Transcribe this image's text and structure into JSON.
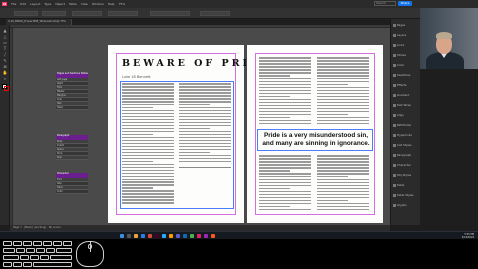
{
  "menubar": {
    "app_logo": "Id",
    "items": [
      "File",
      "Edit",
      "Layout",
      "Type",
      "Object",
      "Table",
      "View",
      "Window",
      "Help"
    ],
    "zoom": "75%",
    "share_label": "Share",
    "search_label": "Search"
  },
  "document": {
    "tab_label": "3-16_BWAR_Proper-BSE_Whereabouts@ 75%"
  },
  "page_left": {
    "headline": "BEWARE OF PRIDE",
    "byline": "Luke 18 Bennett"
  },
  "page_right": {
    "pullquote": "Pride is a very misunderstood sin, and many are sinning in ignorance."
  },
  "notes": [
    {
      "head": "Pages and Sections Notes",
      "rows": [
        "Left page",
        "Right",
        "Folio",
        "Master",
        "Margins",
        "Cols",
        "Text",
        "Head"
      ]
    },
    {
      "head": "Paragraph",
      "rows": [
        "Body",
        "Indent",
        "Space",
        "Drop",
        "Rule"
      ]
    },
    {
      "head": "Character",
      "rows": [
        "Font",
        "Size",
        "Track",
        "Color"
      ]
    }
  ],
  "panels": {
    "items": [
      "Pages",
      "Layers",
      "Links",
      "Stroke",
      "Color",
      "Swatches",
      "Effects",
      "Gradient",
      "Text Wrap",
      "Align",
      "Pathfinder",
      "Hyperlinks",
      "Cell Styles",
      "Paragraph",
      "Character",
      "Obj Styles",
      "Table",
      "Table Styles",
      "Glyphs"
    ]
  },
  "statusbar": {
    "text": "Page 7  ·  [Basic] (working)  ·  No errors"
  },
  "taskbar": {
    "time": "5:55 PM",
    "date": "3/16/2024"
  },
  "colors": {
    "accent": "#1473e6",
    "guide_magenta": "#d56fe0",
    "note_header": "#6b1f8e"
  }
}
